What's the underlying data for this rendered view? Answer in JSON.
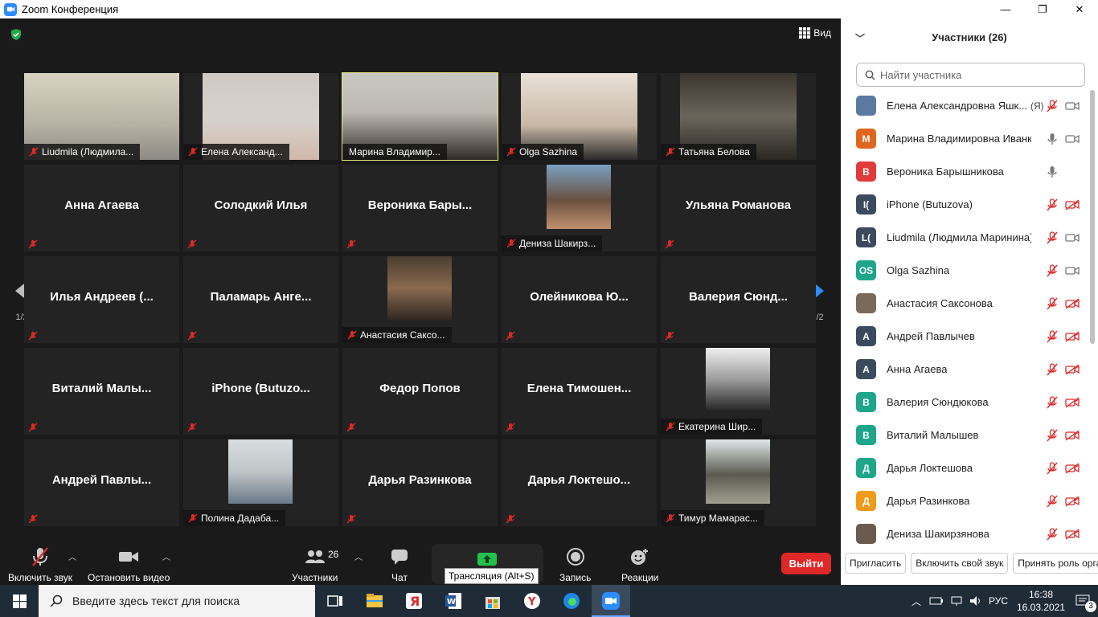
{
  "window": {
    "title": "Zoom Конференция",
    "minimize": "—",
    "maximize": "❐",
    "close": "✕"
  },
  "meeting": {
    "view_label": "Вид",
    "page_indicator_left": "1/2",
    "page_indicator_right": "1/2",
    "tiles": [
      {
        "name": "Liudmila (Людмила...",
        "type": "video"
      },
      {
        "name": "Елена Александ...",
        "type": "video"
      },
      {
        "name": "Марина Владимир...",
        "type": "video",
        "active": true
      },
      {
        "name": "Olga Sazhina",
        "type": "video"
      },
      {
        "name": "Татьяна Белова",
        "type": "video"
      },
      {
        "name": "Анна Агаева",
        "type": "name"
      },
      {
        "name": "Солодкий Илья",
        "type": "name"
      },
      {
        "name": "Вероника  Бары...",
        "type": "name"
      },
      {
        "name": "Дениза Шакирз...",
        "type": "photo"
      },
      {
        "name": "Ульяна Романова",
        "type": "name"
      },
      {
        "name": "Илья Андреев (...",
        "type": "name"
      },
      {
        "name": "Паламарь  Анге...",
        "type": "name"
      },
      {
        "name": "Анастасия Саксо...",
        "type": "photo"
      },
      {
        "name": "Олейникова  Ю...",
        "type": "name"
      },
      {
        "name": "Валерия  Сюнд...",
        "type": "name"
      },
      {
        "name": "Виталий  Малы...",
        "type": "name"
      },
      {
        "name": "iPhone  (Butuzo...",
        "type": "name"
      },
      {
        "name": "Федор Попов",
        "type": "name"
      },
      {
        "name": "Елена  Тимошен...",
        "type": "name"
      },
      {
        "name": "Екатерина Шир...",
        "type": "photo"
      },
      {
        "name": "Андрей  Павлы...",
        "type": "name"
      },
      {
        "name": "Полина Дадаба...",
        "type": "photo"
      },
      {
        "name": "Дарья Разинкова",
        "type": "name"
      },
      {
        "name": "Дарья  Локтешо...",
        "type": "name"
      },
      {
        "name": "Тимур Мамарас...",
        "type": "photo"
      }
    ]
  },
  "toolbar": {
    "mute_label": "Включить звук",
    "video_label": "Остановить видео",
    "participants_label": "Участники",
    "participants_count": "26",
    "chat_label": "Чат",
    "share_tooltip": "Трансляция (Alt+S)",
    "record_label": "Запись",
    "reactions_label": "Реакции",
    "leave_label": "Выйти"
  },
  "panel": {
    "title": "Участники (26)",
    "search_placeholder": "Найти участника",
    "participants": [
      {
        "name": "Елена Александровна Яшк...",
        "tag": "(Я)",
        "initials": "",
        "color": "#5a7aa0",
        "mic": "muted",
        "cam": "on"
      },
      {
        "name": "Марина Владимировна Иванк...",
        "tag": "",
        "initials": "М",
        "color": "#e0651f",
        "mic": "on",
        "cam": "on"
      },
      {
        "name": "Вероника Барышникова",
        "tag": "",
        "initials": "В",
        "color": "#e03a3a",
        "mic": "on",
        "cam": "none"
      },
      {
        "name": "iPhone (Butuzova)",
        "tag": "",
        "initials": "I(",
        "color": "#3b4a5e",
        "mic": "muted",
        "cam": "off"
      },
      {
        "name": "Liudmila (Людмила Маринина)",
        "tag": "",
        "initials": "L(",
        "color": "#3b4a5e",
        "mic": "muted",
        "cam": "on"
      },
      {
        "name": "Olga Sazhina",
        "tag": "",
        "initials": "OS",
        "color": "#1ea58a",
        "mic": "muted",
        "cam": "on"
      },
      {
        "name": "Анастасия Саксонова",
        "tag": "",
        "initials": "",
        "color": "#7a6a5a",
        "mic": "muted",
        "cam": "off"
      },
      {
        "name": "Андрей Павлычев",
        "tag": "",
        "initials": "А",
        "color": "#3b4a5e",
        "mic": "muted",
        "cam": "off"
      },
      {
        "name": "Анна Агаева",
        "tag": "",
        "initials": "А",
        "color": "#3b4a5e",
        "mic": "muted",
        "cam": "off"
      },
      {
        "name": "Валерия Сюндюкова",
        "tag": "",
        "initials": "В",
        "color": "#1ea58a",
        "mic": "muted",
        "cam": "off"
      },
      {
        "name": "Виталий Малышев",
        "tag": "",
        "initials": "В",
        "color": "#1ea58a",
        "mic": "muted",
        "cam": "off"
      },
      {
        "name": "Дарья Локтешова",
        "tag": "",
        "initials": "Д",
        "color": "#1ea58a",
        "mic": "muted",
        "cam": "off"
      },
      {
        "name": "Дарья Разинкова",
        "tag": "",
        "initials": "Д",
        "color": "#f09a1a",
        "mic": "muted",
        "cam": "off"
      },
      {
        "name": "Дениза Шакирзянова",
        "tag": "",
        "initials": "",
        "color": "#6a5a50",
        "mic": "muted",
        "cam": "off"
      }
    ],
    "footer": {
      "invite": "Пригласить",
      "unmute": "Включить свой звук",
      "claim_host": "Принять роль орга"
    }
  },
  "taskbar": {
    "search_placeholder": "Введите здесь текст для поиска",
    "time": "16:38",
    "date": "16.03.2021",
    "lang": "РУС",
    "notifications": "3"
  }
}
